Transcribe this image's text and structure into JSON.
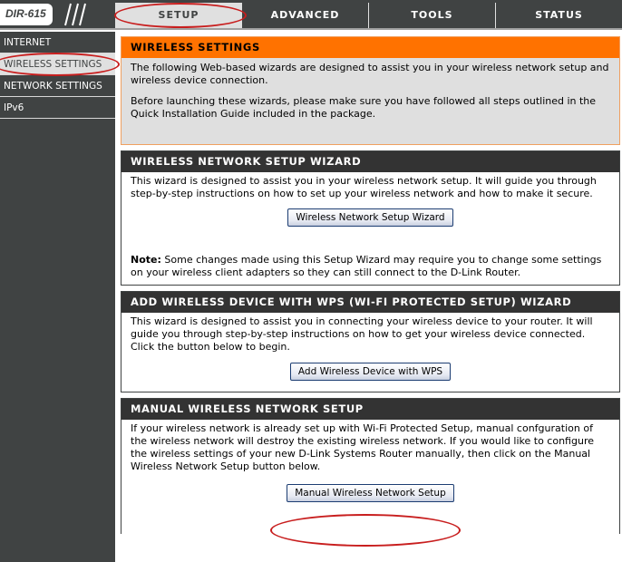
{
  "header": {
    "model": "DIR-615",
    "nav_tabs": [
      {
        "label": "SETUP",
        "active": true
      },
      {
        "label": "ADVANCED",
        "active": false
      },
      {
        "label": "TOOLS",
        "active": false
      },
      {
        "label": "STATUS",
        "active": false
      }
    ]
  },
  "sidebar": {
    "items": [
      {
        "label": "INTERNET",
        "active": false
      },
      {
        "label": "WIRELESS SETTINGS",
        "active": true
      },
      {
        "label": "NETWORK SETTINGS",
        "active": false
      },
      {
        "label": "IPv6",
        "active": false
      }
    ]
  },
  "intro": {
    "title": "WIRELESS SETTINGS",
    "para1": "The following Web-based wizards are designed to assist you in your wireless network setup and wireless device connection.",
    "para2": "Before launching these wizards, please make sure you have followed all steps outlined in the Quick Installation Guide included in the package."
  },
  "setup_wizard": {
    "title": "WIRELESS NETWORK SETUP WIZARD",
    "description": "This wizard is designed to assist you in your wireless network setup. It will guide you through step-by-step instructions on how to set up your wireless network and how to make it secure.",
    "button_label": "Wireless Network Setup Wizard",
    "note_label": "Note:",
    "note_text": " Some changes made using this Setup Wizard may require you to change some settings on your wireless client adapters so they can still connect to the D-Link Router."
  },
  "wps_wizard": {
    "title": "ADD WIRELESS DEVICE WITH WPS (WI-FI PROTECTED SETUP) WIZARD",
    "description": "This wizard is designed to assist you in connecting your wireless device to your router. It will guide you through step-by-step instructions on how to get your wireless device connected. Click the button below to begin.",
    "button_label": "Add Wireless Device with WPS"
  },
  "manual_setup": {
    "title": "MANUAL WIRELESS NETWORK SETUP",
    "description": "If your wireless network is already set up with Wi-Fi Protected Setup, manual confguration of the wireless network will destroy the existing wireless network. If you would like to configure the wireless settings of your new D-Link Systems Router manually, then click on the Manual Wireless Network Setup button below.",
    "button_label": "Manual Wireless Network Setup"
  },
  "colors": {
    "chrome": "#404343",
    "accent_orange": "#ff7200",
    "section_header": "#333333",
    "annotation_red": "#c81e1e"
  }
}
